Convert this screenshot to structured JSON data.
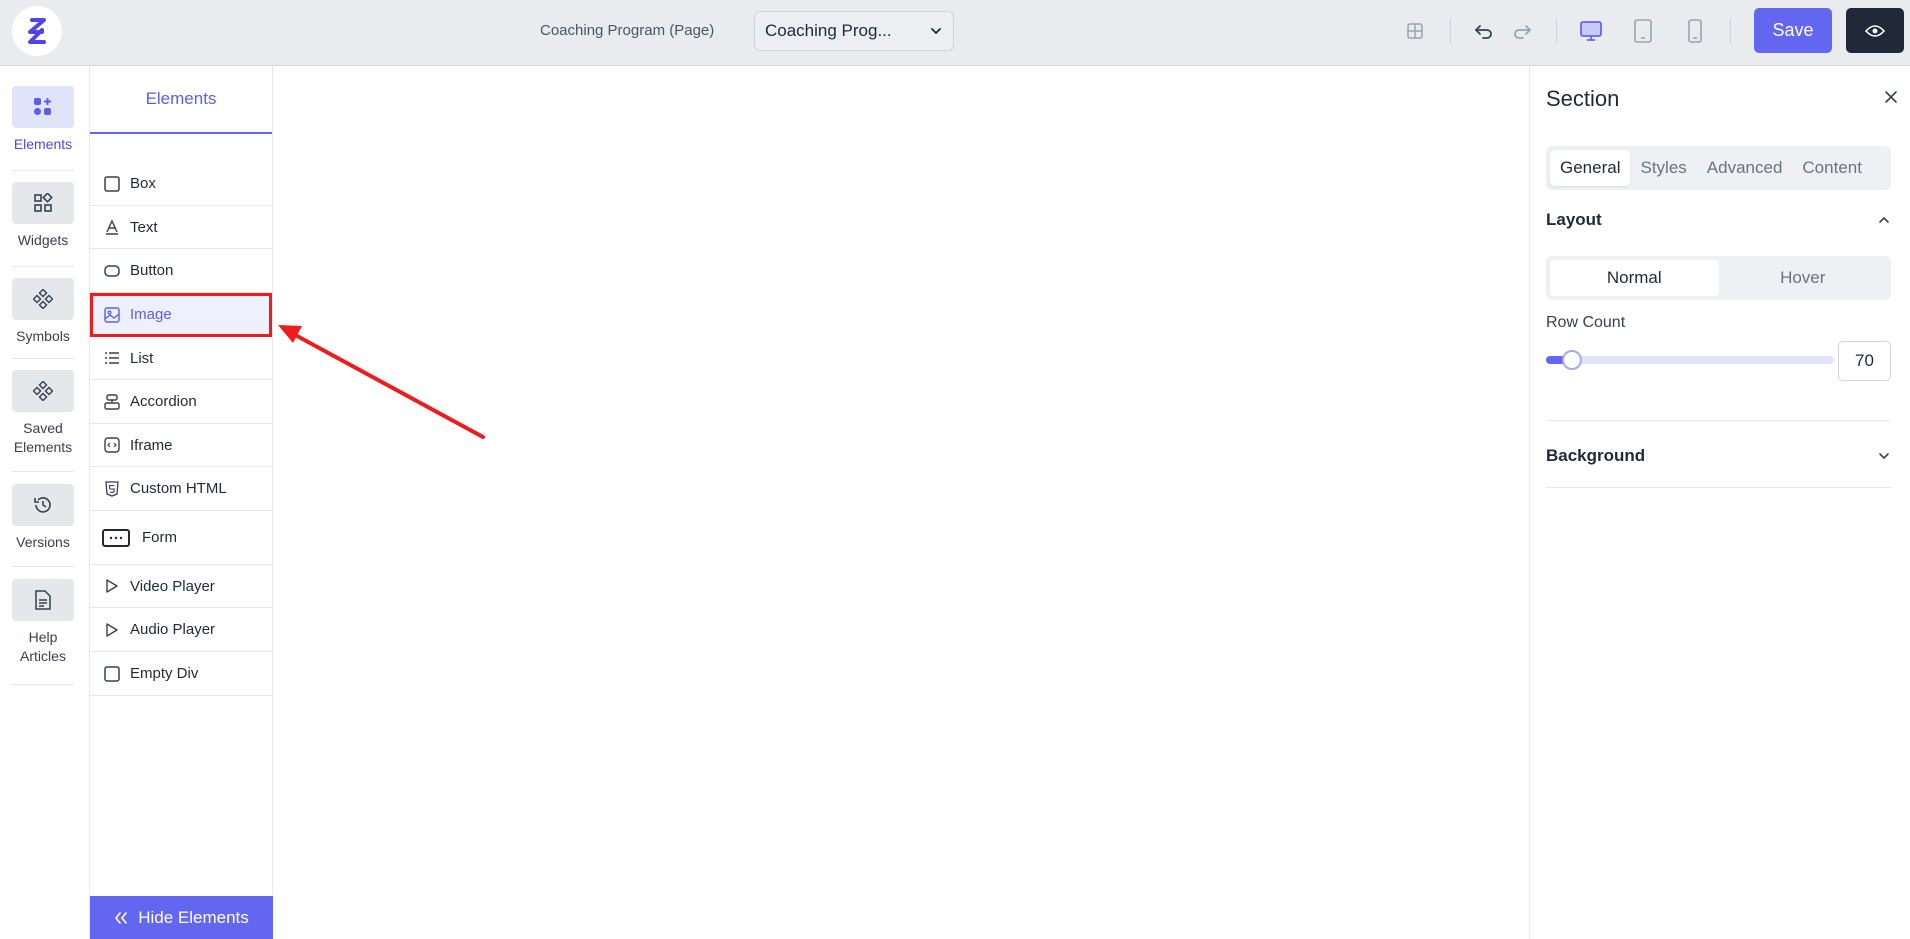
{
  "topbar": {
    "page_caption": "Coaching Program (Page)",
    "page_select_value": "Coaching Prog...",
    "save_label": "Save"
  },
  "rail": {
    "items": [
      {
        "label": "Elements",
        "icon": "elements-icon",
        "active": true
      },
      {
        "label": "Widgets",
        "icon": "widgets-icon"
      },
      {
        "label": "Symbols",
        "icon": "symbols-icon"
      },
      {
        "label": "Saved Elements",
        "icon": "saved-elements-icon"
      },
      {
        "label": "Versions",
        "icon": "history-icon"
      },
      {
        "label": "Help Articles",
        "icon": "document-icon"
      }
    ]
  },
  "panel": {
    "tab_label": "Elements",
    "items": [
      {
        "label": "Box",
        "icon": "square-icon"
      },
      {
        "label": "Text",
        "icon": "text-icon"
      },
      {
        "label": "Button",
        "icon": "button-icon"
      },
      {
        "label": "Image",
        "icon": "image-icon",
        "highlighted": true
      },
      {
        "label": "List",
        "icon": "list-icon"
      },
      {
        "label": "Accordion",
        "icon": "accordion-icon"
      },
      {
        "label": "Iframe",
        "icon": "code-icon"
      },
      {
        "label": "Custom HTML",
        "icon": "html-icon"
      },
      {
        "label": "Form",
        "icon": "form-icon"
      },
      {
        "label": "Video Player",
        "icon": "play-icon"
      },
      {
        "label": "Audio Player",
        "icon": "play-icon"
      },
      {
        "label": "Empty Div",
        "icon": "square-icon"
      }
    ],
    "hide_label": "Hide Elements"
  },
  "inspector": {
    "title": "Section",
    "tabs": [
      "General",
      "Styles",
      "Advanced",
      "Content"
    ],
    "active_tab": "General",
    "layout_heading": "Layout",
    "states": [
      "Normal",
      "Hover"
    ],
    "active_state": "Normal",
    "row_count_label": "Row Count",
    "row_count_value": "70",
    "row_count_slider_fraction": 0.07,
    "background_heading": "Background"
  },
  "colors": {
    "accent": "#6366f1",
    "annotation": "#ee1c1c"
  }
}
